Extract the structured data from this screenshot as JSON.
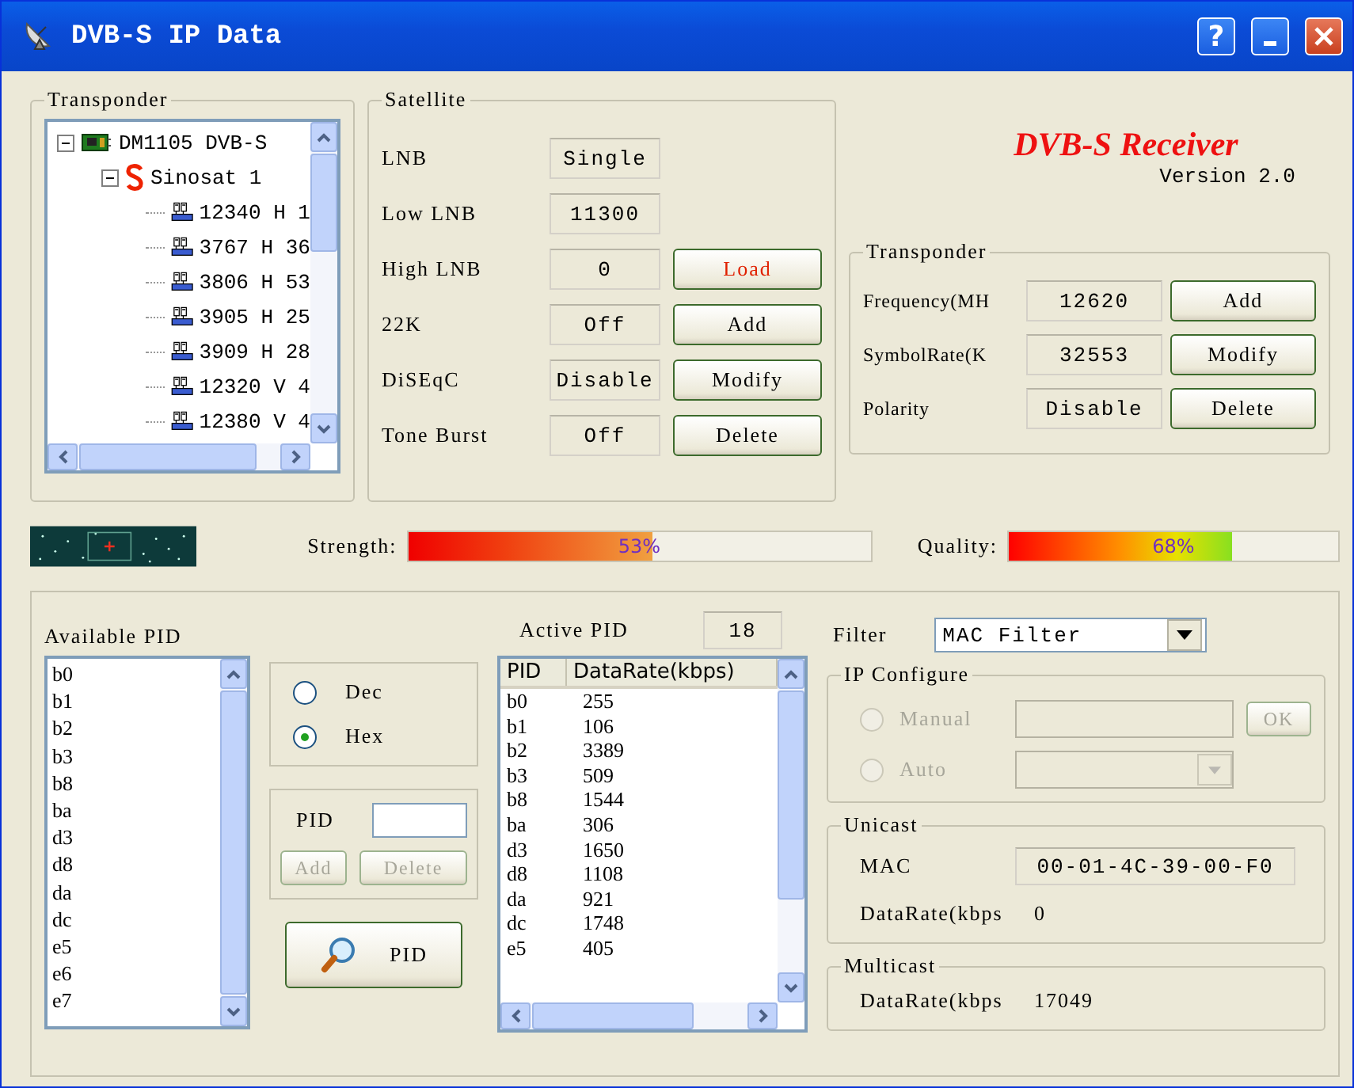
{
  "window": {
    "title": "DVB-S IP Data",
    "help": "?"
  },
  "transponder_tree": {
    "title": "Transponder",
    "items": [
      {
        "label": "DM1105 DVB-S",
        "kind": "device",
        "expanded": true,
        "children": [
          {
            "label": "Sinosat 1",
            "kind": "satellite",
            "expanded": true,
            "children": [
              {
                "label": "12340 H 1",
                "kind": "transponder"
              },
              {
                "label": "3767 H 36",
                "kind": "transponder"
              },
              {
                "label": "3806 H 53",
                "kind": "transponder"
              },
              {
                "label": "3905 H 25",
                "kind": "transponder"
              },
              {
                "label": "3909 H 28",
                "kind": "transponder"
              },
              {
                "label": "12320 V 4",
                "kind": "transponder"
              },
              {
                "label": "12380 V 4",
                "kind": "transponder"
              }
            ]
          }
        ]
      }
    ]
  },
  "satellite": {
    "title": "Satellite",
    "rows": [
      {
        "label": "LNB",
        "value": "Single"
      },
      {
        "label": "Low LNB",
        "value": "11300"
      },
      {
        "label": "High LNB",
        "value": "0",
        "button": "Load",
        "highlighted": true
      },
      {
        "label": "22K",
        "value": "Off",
        "button": "Add",
        "highlighted": false
      },
      {
        "label": "DiSEqC",
        "value": "Disable",
        "button": "Modify",
        "highlighted": false
      },
      {
        "label": "Tone Burst",
        "value": "Off",
        "button": "Delete",
        "highlighted": false
      }
    ]
  },
  "brand": {
    "name": "DVB-S Receiver",
    "version": "Version 2.0"
  },
  "transponder": {
    "title": "Transponder",
    "rows": [
      {
        "label": "Frequency(MH",
        "value": "12620",
        "button": "Add"
      },
      {
        "label": "SymbolRate(K",
        "value": "32553",
        "button": "Modify"
      },
      {
        "label": "Polarity",
        "value": "Disable",
        "button": "Delete"
      }
    ]
  },
  "strength": {
    "label": "Strength:",
    "reading": "53%",
    "level": 0.53
  },
  "quality": {
    "label": "Quality:",
    "reading": "68%",
    "level": 0.68
  },
  "available_pid": {
    "title": "Available PID",
    "items": [
      "b0",
      "b1",
      "b2",
      "b3",
      "b8",
      "ba",
      "d3",
      "d8",
      "da",
      "dc",
      "e5",
      "e6",
      "e7"
    ]
  },
  "format": [
    {
      "label": "Dec",
      "selected": false
    },
    {
      "label": "Hex",
      "selected": true
    }
  ],
  "pid_entry": {
    "label": "PID",
    "buttons": [
      {
        "label": "Add",
        "disabled": true
      },
      {
        "label": "Delete",
        "disabled": true
      }
    ]
  },
  "search_button": "PID",
  "active_pid": {
    "title": "Active PID",
    "count": "18",
    "columns": [
      "PID",
      "DataRate(kbps)"
    ],
    "rows": [
      [
        "b0",
        "255"
      ],
      [
        "b1",
        "106"
      ],
      [
        "b2",
        "3389"
      ],
      [
        "b3",
        "509"
      ],
      [
        "b8",
        "1544"
      ],
      [
        "ba",
        "306"
      ],
      [
        "d3",
        "1650"
      ],
      [
        "d8",
        "1108"
      ],
      [
        "da",
        "921"
      ],
      [
        "dc",
        "1748"
      ],
      [
        "e5",
        "405"
      ]
    ]
  },
  "filter": {
    "label": "Filter",
    "value": "MAC Filter"
  },
  "ip_configure": {
    "title": "IP Configure",
    "disabled": true,
    "options": [
      {
        "label": "Manual",
        "selected": false,
        "kind": "address"
      },
      {
        "label": "Auto",
        "selected": false,
        "kind": "dropdown"
      }
    ],
    "ok": "OK"
  },
  "unicast": {
    "title": "Unicast",
    "mac_label": "MAC",
    "mac": "00-01-4C-39-00-F0",
    "rate_label": "DataRate(kbps",
    "rate": "0"
  },
  "multicast": {
    "title": "Multicast",
    "rate_label": "DataRate(kbps",
    "rate": "17049"
  }
}
